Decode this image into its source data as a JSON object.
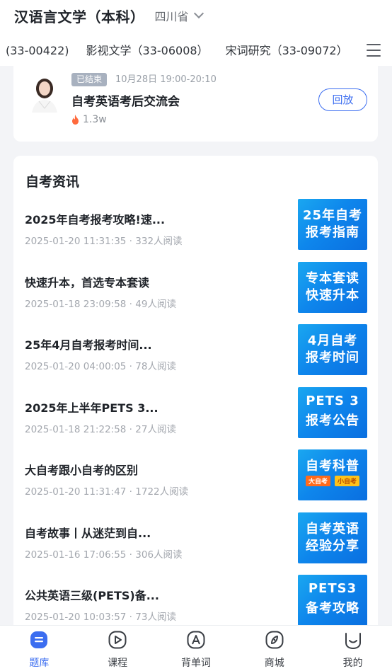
{
  "header": {
    "major_title": "汉语言文学（本科）",
    "province": "四川省",
    "tabs": [
      "(33-00422)",
      "影视文学（33-06008）",
      "宋词研究（33-09072）"
    ]
  },
  "live": {
    "status_badge": "已结束",
    "time": "10月28日 19:00-20:10",
    "title": "自考英语考后交流会",
    "views": "1.3w",
    "replay_label": "回放"
  },
  "news": {
    "header": "自考资讯",
    "items": [
      {
        "title": "2025年自考报考攻略!速...",
        "date": "2025-01-20 11:31:35",
        "reads": "332人阅读",
        "thumb_l1": "25年自考",
        "thumb_l2": "报考指南",
        "thumb_tags": []
      },
      {
        "title": "快速升本，首选专本套读",
        "date": "2025-01-18 23:09:58",
        "reads": "49人阅读",
        "thumb_l1": "专本套读",
        "thumb_l2": "快速升本",
        "thumb_tags": []
      },
      {
        "title": "25年4月自考报考时间...",
        "date": "2025-01-20 04:00:05",
        "reads": "78人阅读",
        "thumb_l1": "4月自考",
        "thumb_l2": "报考时间",
        "thumb_tags": []
      },
      {
        "title": "2025年上半年PETS 3...",
        "date": "2025-01-18 21:22:58",
        "reads": "27人阅读",
        "thumb_l1": "PETS 3",
        "thumb_l2": "报考公告",
        "thumb_tags": []
      },
      {
        "title": "大自考跟小自考的区别",
        "date": "2025-01-20 11:31:47",
        "reads": "1722人阅读",
        "thumb_l1": "自考科普",
        "thumb_l2": "",
        "thumb_tags": [
          "大自考",
          "小自考"
        ]
      },
      {
        "title": "自考故事丨从迷茫到自...",
        "date": "2025-01-16 17:06:55",
        "reads": "306人阅读",
        "thumb_l1": "自考英语",
        "thumb_l2": "经验分享",
        "thumb_tags": []
      },
      {
        "title": "公共英语三级(PETS)备...",
        "date": "2025-01-20 10:03:57",
        "reads": "73人阅读",
        "thumb_l1": "PETS3",
        "thumb_l2": "备考攻略",
        "thumb_tags": []
      }
    ]
  },
  "bottom_nav": {
    "items": [
      {
        "label": "题库",
        "icon": "question-bank-icon",
        "active": true
      },
      {
        "label": "课程",
        "icon": "play-icon",
        "active": false
      },
      {
        "label": "背单词",
        "icon": "letter-a-icon",
        "active": false
      },
      {
        "label": "商城",
        "icon": "compass-icon",
        "active": false
      },
      {
        "label": "我的",
        "icon": "smile-icon",
        "active": false
      }
    ]
  },
  "colors": {
    "accent": "#3b6df0",
    "thumb_blue": "#0e86ec",
    "badge_grey": "#a8b1bf"
  }
}
